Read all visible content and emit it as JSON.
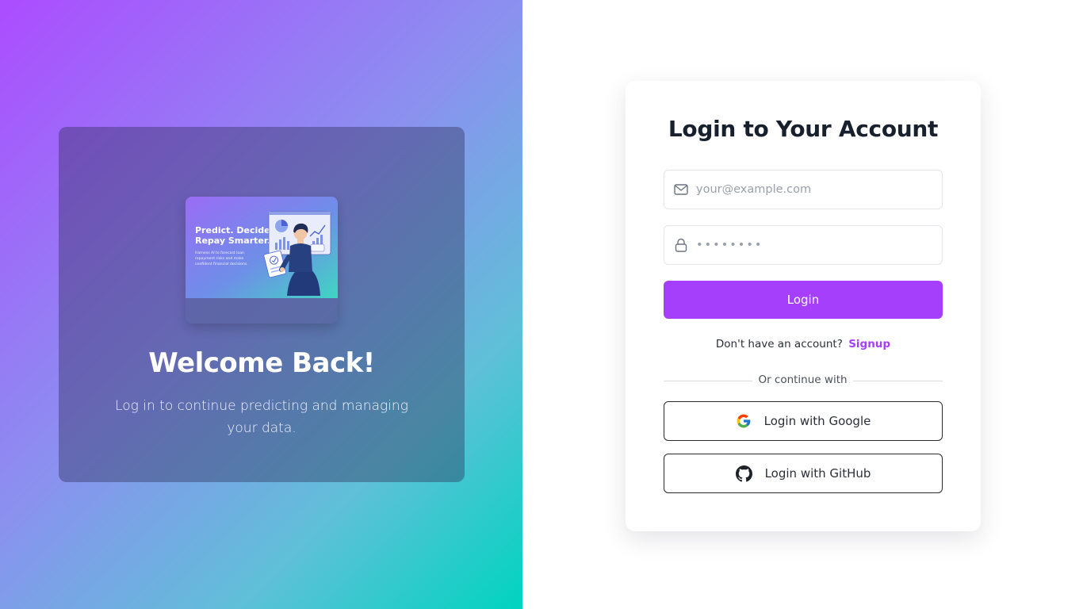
{
  "hero": {
    "illustration": {
      "headline_line1": "Predict. Decide.",
      "headline_line2": "Repay Smarter.",
      "body_line1": "Harness AI to forecast loan",
      "body_line2": "repayment risks and make",
      "body_line3": "confident financial decisions."
    },
    "title": "Welcome Back!",
    "subtitle": "Log in to continue predicting and managing your data."
  },
  "login": {
    "title": "Login to Your Account",
    "email_placeholder": "your@example.com",
    "email_value": "",
    "password_placeholder": "••••••••",
    "password_value": "",
    "button_label": "Login",
    "signup_prompt": "Don't have an account?",
    "signup_link": "Signup",
    "divider_text": "Or continue with",
    "google_label": "Login with Google",
    "github_label": "Login with GitHub"
  },
  "icons": {
    "email": "mail-icon",
    "password": "lock-icon",
    "google": "google-icon",
    "github": "github-icon"
  },
  "colors": {
    "accent": "#a63ffb",
    "gradient_start": "#ac4cff",
    "gradient_end": "#00d4c0",
    "title_text": "#18202e"
  }
}
